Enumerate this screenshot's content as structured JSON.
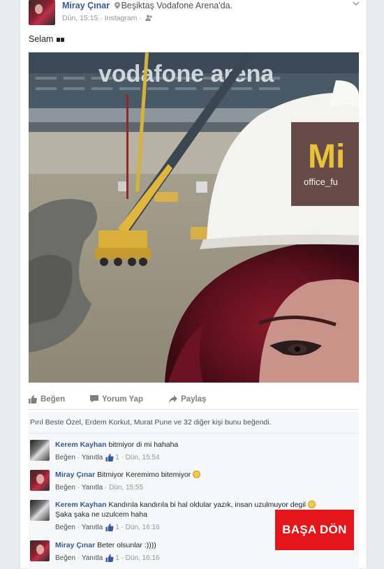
{
  "post": {
    "author": "Miray Çınar",
    "location": "Beşiktaş Vodafone Arena'da.",
    "time": "Dün, 15:15 · Instagram ·",
    "status_text": "Selam"
  },
  "photo": {
    "stadium_sign": "vodafone arena",
    "helmet_text": "Mi",
    "helmet_subtext": "office_fu"
  },
  "actions": {
    "like": "Beğen",
    "comment": "Yorum Yap",
    "share": "Paylaş"
  },
  "likes_summary": "Pırıl Beste Özel, Erdem Korkut, Murat Pune ve 32 diğer kişi bunu beğendi.",
  "comments": [
    {
      "author": "Kerem Kayhan",
      "text": "bitmiyor di mi hahaha",
      "like_label": "Beğen",
      "reply_label": "Yanıtla",
      "like_count": "1",
      "time": "Dün, 15:54"
    },
    {
      "author": "Miray Çınar",
      "text": "Bitmiyor Keremimo bitemiyor",
      "like_label": "Beğen",
      "reply_label": "Yanıtla",
      "time": "Dün, 15:55"
    },
    {
      "author": "Kerem Kayhan",
      "text": "Kandırıla kandırıla bi hal oldular yazık, insan uzulmuyor degil",
      "text2": "Şaka şaka ne uzulcem haha",
      "like_label": "Beğen",
      "reply_label": "Yanıtla",
      "like_count": "1",
      "time": "Dün, 16:16"
    },
    {
      "author": "Miray Çınar",
      "text": "Beter olsunlar :))))",
      "like_label": "Beğen",
      "reply_label": "Yanıtla",
      "like_count": "1",
      "time": "Dün, 16:16"
    }
  ],
  "overlay_button": "BAŞA DÖN",
  "colors": {
    "link_blue": "#365899",
    "overlay_red": "#e3161b",
    "background": "#e9ebee"
  }
}
